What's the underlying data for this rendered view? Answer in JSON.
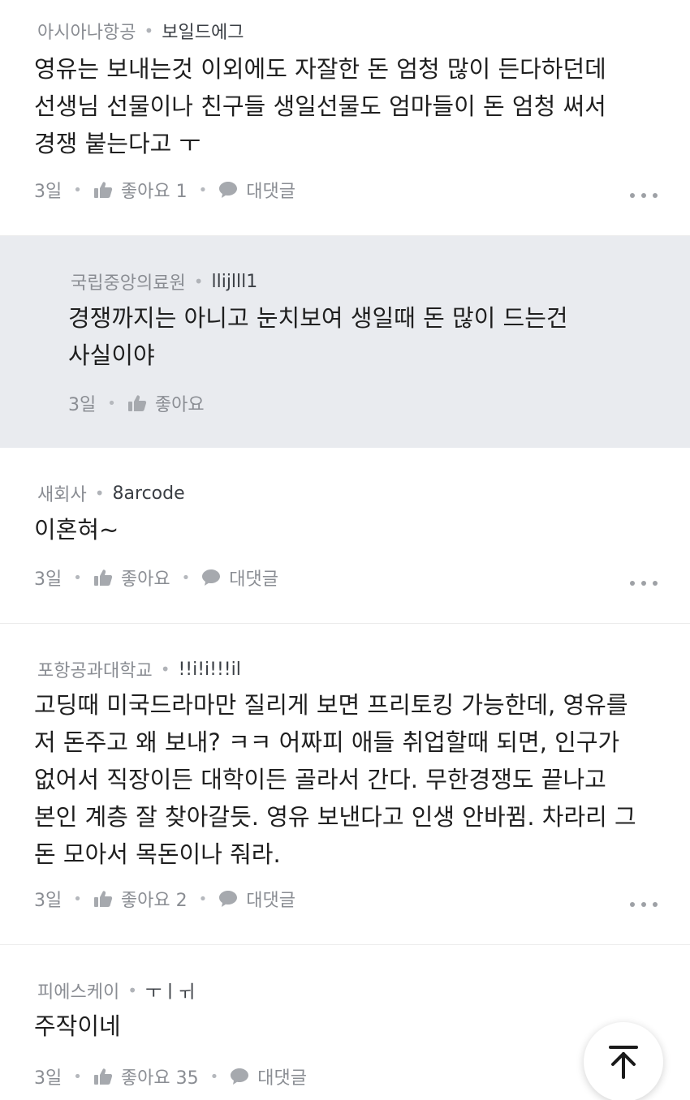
{
  "comments": [
    {
      "company": "아시아나항공",
      "nickname": "보일드에그",
      "lines": [
        "영유는 보내는것 이외에도 자잘한 돈 엄청 많이 든다하던데",
        "선생님 선물이나 친구들 생일선물도 엄마들이 돈 엄청 써서",
        "경쟁 붙는다고 ㅜ"
      ],
      "time": "3일",
      "like_label": "좋아요 1",
      "reply_label": "대댓글"
    },
    {
      "company": "국립중앙의료원",
      "nickname": "llijlll1",
      "lines": [
        "경쟁까지는 아니고 눈치보여 생일때 돈 많이 드는건",
        "사실이야"
      ],
      "time": "3일",
      "like_label": "좋아요"
    },
    {
      "company": "새회사",
      "nickname": "8arcode",
      "lines": [
        "이혼혀~"
      ],
      "time": "3일",
      "like_label": "좋아요",
      "reply_label": "대댓글"
    },
    {
      "company": "포항공과대학교",
      "nickname": "!!i!i!!!il",
      "lines": [
        "고딩때 미국드라마만 질리게 보면 프리토킹 가능한데, 영유를",
        "저 돈주고 왜 보내? ㅋㅋ 어짜피 애들 취업할때 되면, 인구가",
        "없어서 직장이든 대학이든 골라서 간다. 무한경쟁도 끝나고",
        "본인 계층 잘 찾아갈듯. 영유 보낸다고 인생 안바뀜. 차라리 그",
        "돈 모아서 목돈이나 줘라."
      ],
      "time": "3일",
      "like_label": "좋아요 2",
      "reply_label": "대댓글"
    },
    {
      "company": "피에스케이",
      "nickname": "ㅜㅣㅟ",
      "lines": [
        "주작이네"
      ],
      "time": "3일",
      "like_label": "좋아요 35",
      "reply_label": "대댓글"
    }
  ],
  "icons": {
    "like": "thumbs-up-icon",
    "reply": "speech-bubble-icon",
    "more": "more-dots-icon",
    "scroll_top": "arrow-up-to-line-icon"
  },
  "colors": {
    "reply_background": "#e9ebef",
    "meta_text": "#8a8d93",
    "body_text": "#1f1f1f"
  }
}
